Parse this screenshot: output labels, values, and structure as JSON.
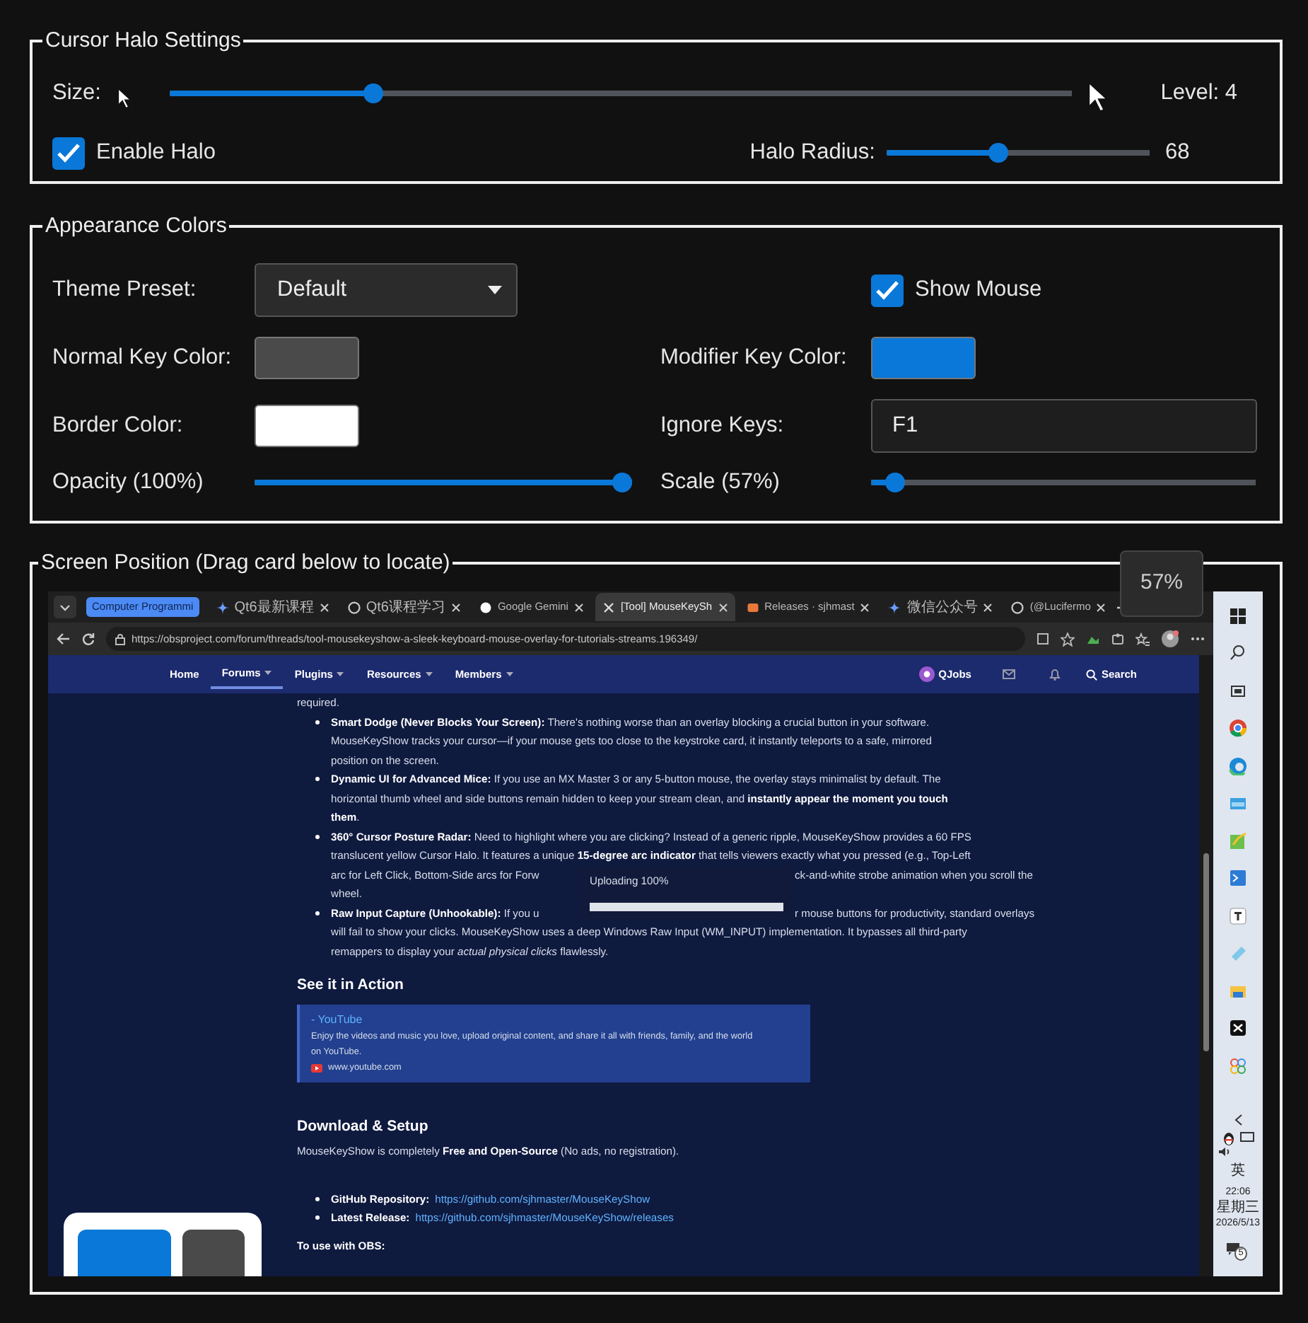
{
  "halo_settings": {
    "legend": "Cursor  Halo Settings",
    "size_label": "Size:",
    "size_slider": {
      "level": 0.22
    },
    "level_text": "Level: 4",
    "enable_halo": {
      "label": "Enable Halo",
      "checked": true
    },
    "radius_label": "Halo Radius:",
    "radius_slider": {
      "level": 0.42
    },
    "radius_value": "68"
  },
  "appearance_colors": {
    "legend": "Appearance  Colors",
    "theme_label": "Theme Preset:",
    "theme_value": "Default",
    "show_mouse": {
      "label": "Show Mouse",
      "checked": true
    },
    "normal_key_label": "Normal Key Color:",
    "normal_key_swatch": {
      "color": "#4a4a4a"
    },
    "modifier_key_label": "Modifier Key Color:",
    "modifier_key_swatch": {
      "color": "#0a78d8"
    },
    "border_label": "Border Color:",
    "border_swatch": {
      "color": "#ffffff"
    },
    "ignore_label": "Ignore Keys:",
    "ignore_value": "F1",
    "opacity_label": "Opacity (100%)",
    "opacity_slider": {
      "level": 1
    },
    "scale_label": "Scale (57%)",
    "scale_slider": {
      "level": 0.04
    }
  },
  "screen_position": {
    "legend": "Screen Position (Drag card below to locate)",
    "scale_tooltip": "57%",
    "browser": {
      "tab_group": "Computer Programmi",
      "tabs": [
        {
          "title": "Qt6最新课程",
          "selected": false
        },
        {
          "title": "Qt6课程学习",
          "selected": false
        },
        {
          "title": "Google Gemini",
          "selected": false
        },
        {
          "title": "[Tool] MouseKeySh",
          "selected": true
        },
        {
          "title": "Releases · sjhmast",
          "selected": false
        },
        {
          "title": "微信公众号",
          "selected": false
        },
        {
          "title": "(@Lucifermo",
          "selected": false
        }
      ],
      "url": "https://obsproject.com/forum/threads/tool-mousekeyshow-a-sleek-keyboard-mouse-overlay-for-tutorials-streams.196349/",
      "nav": [
        {
          "label": "Home",
          "selected": false,
          "dropdown": false
        },
        {
          "label": "Forums",
          "selected": true,
          "dropdown": true
        },
        {
          "label": "Plugins",
          "selected": false,
          "dropdown": true
        },
        {
          "label": "Resources",
          "selected": false,
          "dropdown": true
        },
        {
          "label": "Members",
          "selected": false,
          "dropdown": true
        }
      ],
      "jobs": "QJobs",
      "search": "Search"
    },
    "article": {
      "top_line": "required.",
      "features": [
        {
          "lines": [
            [
              "**Smart Dodge (Never Blocks Your Screen):** There's nothing worse than an overlay blocking a crucial button in your software."
            ],
            [
              "MouseKeyShow tracks your cursor—if your mouse gets too close to the keystroke card, it instantly teleports to a safe, mirrored"
            ],
            [
              "position on the screen."
            ]
          ]
        },
        {
          "lines": [
            [
              "**Dynamic UI for Advanced Mice:** If you use an MX Master 3 or any 5-button mouse, the overlay stays minimalist by default. The"
            ],
            [
              "horizontal thumb wheel and side buttons remain hidden to keep your stream clean, and **instantly appear the moment you touch**"
            ],
            [
              "**them**."
            ]
          ]
        },
        {
          "lines": [
            [
              "**360° Cursor Posture Radar:** Need to highlight where you are clicking? Instead of a generic ripple, MouseKeyShow provides a 60 FPS"
            ],
            [
              "translucent yellow Cursor Halo. It features a unique **15-degree arc indicator** that tells viewers exactly what you pressed (e.g., Top-Left"
            ],
            [
              "arc for Left Click, Bottom-Side arcs for Forw",
              "ck-and-white strobe animation when you scroll the"
            ],
            [
              "wheel."
            ]
          ]
        },
        {
          "lines": [
            [
              "**Raw Input Capture (Unhookable):** If you u",
              "r mouse buttons for productivity, standard overlays"
            ],
            [
              "will fail to show your clicks. MouseKeyShow uses a deep Windows Raw Input (WM_INPUT) implementation. It bypasses all third-party"
            ],
            [
              "remappers to display your *actual physical clicks* flawlessly."
            ]
          ]
        }
      ],
      "upload_dialog": {
        "text": "Uploading 100%",
        "level": 1
      },
      "action_heading": "See it in Action",
      "embed": {
        "title": "- YouTube",
        "lines": [
          "Enjoy the videos and music you love, upload original content, and share it all with friends, family, and the world",
          "on YouTube."
        ],
        "site": "www.youtube.com"
      },
      "download_heading": "Download & Setup",
      "download_text": "MouseKeyShow is completely **Free and Open-Source** (No ads, no registration).",
      "links": [
        {
          "label": "**GitHub Repository:**",
          "url": "https://github.com/sjhmaster/MouseKeyShow"
        },
        {
          "label": "**Latest Release:**",
          "url": "https://github.com/sjhmaster/MouseKeyShow/releases"
        }
      ],
      "obs_heading": "To use with OBS:"
    },
    "taskbar": {
      "input_method": "英",
      "time": "22:06",
      "weekday": "星期三",
      "date": "2026/5/13",
      "notification_count": "5"
    }
  }
}
